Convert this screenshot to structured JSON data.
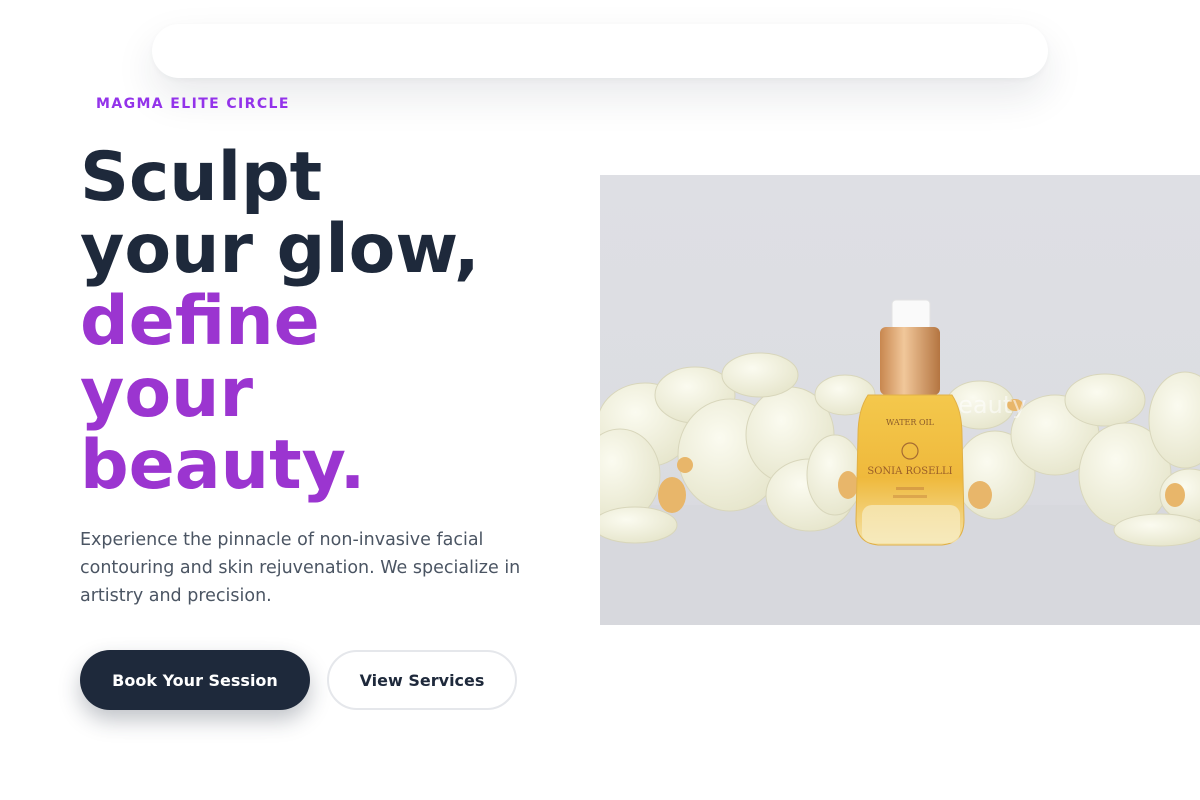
{
  "brand": {
    "eyebrow": "MAGMA ELITE CIRCLE",
    "accent_color": "#9333ea",
    "dark_color": "#1e293b"
  },
  "hero": {
    "headline_line_1": "Sculpt",
    "headline_line_2": "your glow,",
    "headline_line_3": "define",
    "headline_line_4": "your",
    "headline_line_5": "beauty.",
    "intro": "Experience the pinnacle of non-invasive facial contouring and skin rejuvenation. We specialize in artistry and precision.",
    "primary_cta": "Book Your Session",
    "secondary_cta": "View Services"
  },
  "photo": {
    "watermark": "laya.beauty",
    "bottle_label_1": "WATER OIL",
    "bottle_label_2": "SONIA ROSELLI"
  }
}
